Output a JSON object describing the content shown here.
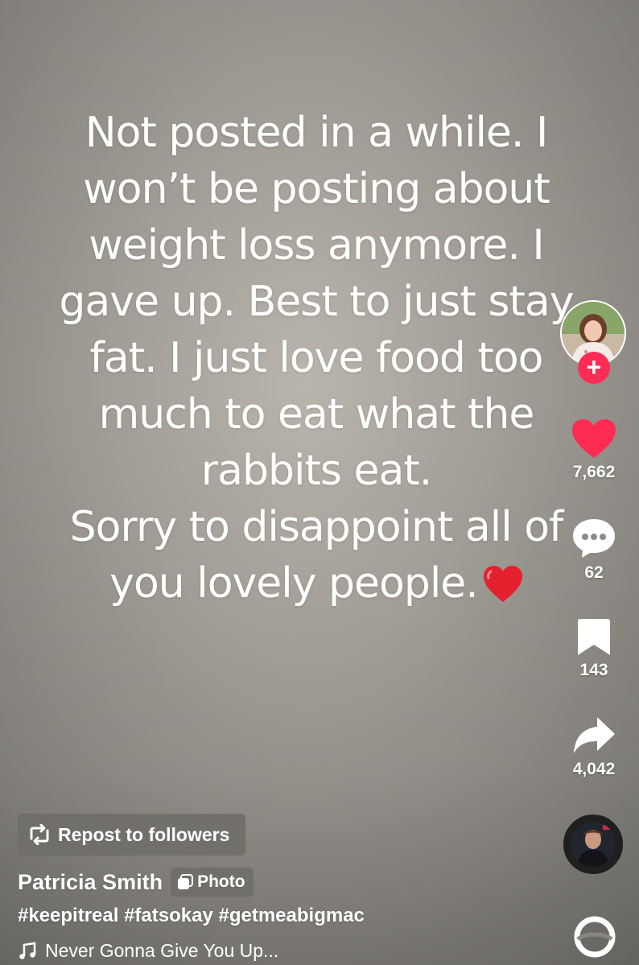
{
  "post": {
    "text_lines": [
      "Not posted in a while. I",
      "won’t be posting about",
      "weight loss anymore. I",
      "gave up. Best to just stay",
      "fat. I just love food too",
      "much to eat what the",
      "rabbits eat.",
      "Sorry to disappoint all of",
      "you lovely people."
    ],
    "emoji": "red-heart-emoji"
  },
  "rail": {
    "follow_symbol": "+",
    "likes": "7,662",
    "comments": "62",
    "saves": "143",
    "shares": "4,042"
  },
  "bottom": {
    "repost_label": "Repost to followers",
    "author_name": "Patricia Smith",
    "badge_label": "Photo",
    "hashtags": "#keepitreal #fatsokay #getmeabigmac",
    "music_title": "Never Gonna Give You Up..."
  },
  "colors": {
    "like_red": "#fe2c55",
    "heart_emoji": "#e5202e",
    "text": "#ffffff"
  },
  "icons": [
    "heart-icon",
    "comment-icon",
    "bookmark-icon",
    "share-icon",
    "repost-icon",
    "photo-icon",
    "music-note-icon",
    "ring-icon"
  ]
}
